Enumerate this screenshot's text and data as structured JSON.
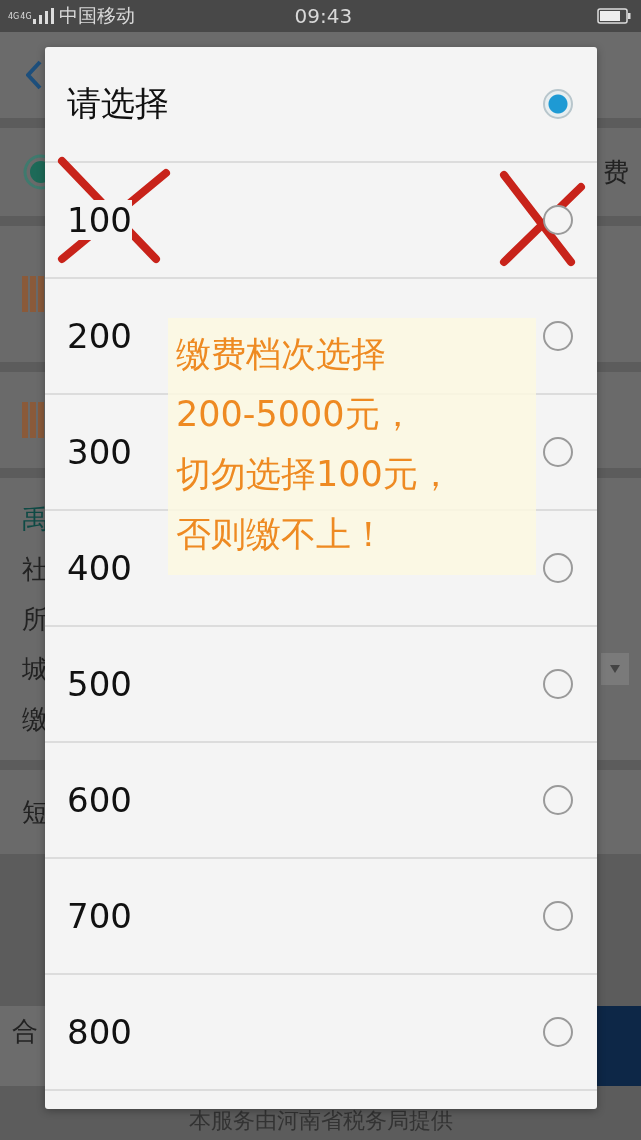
{
  "status_bar": {
    "network": [
      "4G",
      "4G"
    ],
    "carrier": "中国移动",
    "time": "09:43"
  },
  "background": {
    "right_label": "费",
    "section_heading": "禹",
    "field_labels": [
      "社",
      "所",
      "城",
      "缴"
    ],
    "sms_label": "短",
    "bottom_label": "合",
    "footer": "本服务由河南省税务局提供"
  },
  "dialog": {
    "options": [
      {
        "label": "请选择",
        "selected": true,
        "crossed": false
      },
      {
        "label": "100",
        "selected": false,
        "crossed": true
      },
      {
        "label": "200",
        "selected": false,
        "crossed": false
      },
      {
        "label": "300",
        "selected": false,
        "crossed": false
      },
      {
        "label": "400",
        "selected": false,
        "crossed": false
      },
      {
        "label": "500",
        "selected": false,
        "crossed": false
      },
      {
        "label": "600",
        "selected": false,
        "crossed": false
      },
      {
        "label": "700",
        "selected": false,
        "crossed": false
      },
      {
        "label": "800",
        "selected": false,
        "crossed": false
      }
    ]
  },
  "note": {
    "lines": [
      "缴费档次选择",
      "200-5000元，",
      "切勿选择100元，",
      "否则缴不上！"
    ]
  }
}
